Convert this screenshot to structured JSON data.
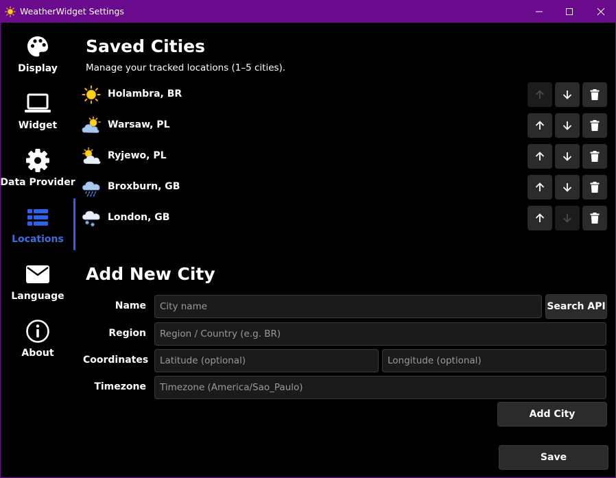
{
  "window": {
    "title": "WeatherWidget Settings",
    "title_bg": "#6a0a8c"
  },
  "sidebar": {
    "accent": "#2d63e8",
    "items": [
      {
        "label": "Display",
        "icon": "palette-icon",
        "active": false
      },
      {
        "label": "Widget",
        "icon": "laptop-icon",
        "active": false
      },
      {
        "label": "Data Provider",
        "icon": "gear-icon",
        "active": false
      },
      {
        "label": "Locations",
        "icon": "list-icon",
        "active": true
      },
      {
        "label": "Language",
        "icon": "envelope-icon",
        "active": false
      },
      {
        "label": "About",
        "icon": "info-icon",
        "active": false
      }
    ]
  },
  "saved": {
    "title": "Saved Cities",
    "subtitle": "Manage your tracked locations (1–5 cities).",
    "cities": [
      {
        "name": "Holambra, BR",
        "icon": "sun-icon",
        "up_enabled": false,
        "down_enabled": true
      },
      {
        "name": "Warsaw, PL",
        "icon": "partly-cloudy-icon",
        "up_enabled": true,
        "down_enabled": true
      },
      {
        "name": "Ryjewo, PL",
        "icon": "sun-behind-cloud-icon",
        "up_enabled": true,
        "down_enabled": true
      },
      {
        "name": "Broxburn, GB",
        "icon": "rain-cloud-icon",
        "up_enabled": true,
        "down_enabled": true
      },
      {
        "name": "London, GB",
        "icon": "snow-cloud-icon",
        "up_enabled": true,
        "down_enabled": false
      }
    ]
  },
  "add": {
    "title": "Add New City",
    "name_label": "Name",
    "name_placeholder": "City name",
    "search_label": "Search API",
    "region_label": "Region",
    "region_placeholder": "Region / Country (e.g. BR)",
    "coords_label": "Coordinates",
    "lat_placeholder": "Latitude (optional)",
    "lon_placeholder": "Longitude (optional)",
    "tz_label": "Timezone",
    "tz_placeholder": "Timezone (America/Sao_Paulo)",
    "add_label": "Add City"
  },
  "footer": {
    "save_label": "Save"
  }
}
